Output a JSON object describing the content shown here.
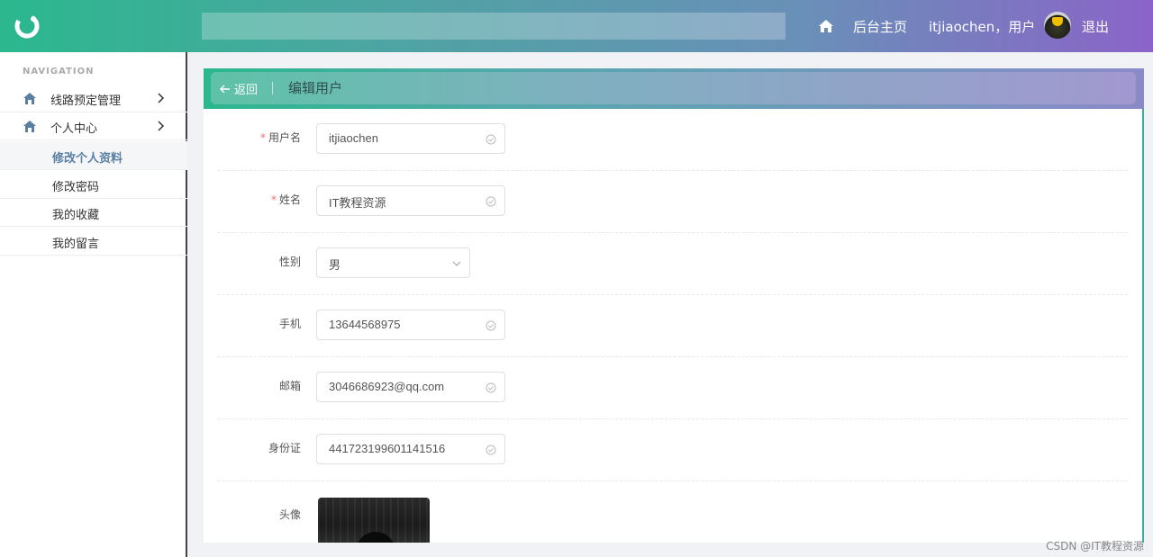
{
  "header": {
    "home_label": "后台主页",
    "user_label": "itjiaochen，用户",
    "logout_label": "退出"
  },
  "sidebar": {
    "nav_title": "NAVIGATION",
    "menus": [
      {
        "label": "线路预定管理"
      },
      {
        "label": "个人中心"
      }
    ],
    "sub_items": [
      {
        "label": "修改个人资料"
      },
      {
        "label": "修改密码"
      },
      {
        "label": "我的收藏"
      },
      {
        "label": "我的留言"
      }
    ]
  },
  "panel": {
    "back_label": "返回",
    "title": "编辑用户"
  },
  "form": {
    "username": {
      "label": "用户名",
      "value": "itjiaochen"
    },
    "name": {
      "label": "姓名",
      "value": "IT教程资源"
    },
    "gender": {
      "label": "性别",
      "value": "男"
    },
    "phone": {
      "label": "手机",
      "value": "13644568975"
    },
    "email": {
      "label": "邮箱",
      "value": "3046686923@qq.com"
    },
    "idcard": {
      "label": "身份证",
      "value": "441723199601141516"
    },
    "avatar": {
      "label": "头像"
    }
  },
  "watermark": "CSDN @IT教程资源",
  "colors": {
    "accent": "#2bb88e",
    "header_end": "#8a64c8",
    "required": "#f56c6c",
    "active_menu": "#5b7fa3"
  }
}
